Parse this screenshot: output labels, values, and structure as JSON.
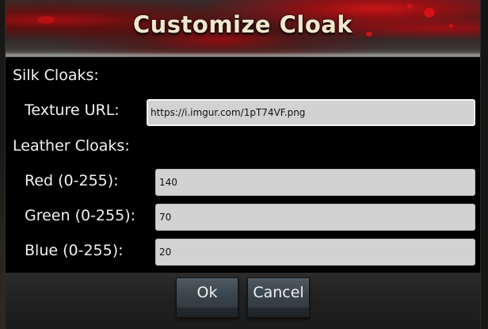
{
  "dialog": {
    "title": "Customize Cloak"
  },
  "silk_section": {
    "label": "Silk Cloaks:",
    "texture_url": {
      "label": "Texture URL:",
      "value": "https://i.imgur.com/1pT74VF.png"
    }
  },
  "leather_section": {
    "label": "Leather Cloaks:",
    "red": {
      "label": "Red (0-255):",
      "value": "140"
    },
    "green": {
      "label": "Green (0-255):",
      "value": "70"
    },
    "blue": {
      "label": "Blue (0-255):",
      "value": "20"
    }
  },
  "buttons": {
    "ok": "Ok",
    "cancel": "Cancel"
  },
  "colors": {
    "banner_red": "#c8161a",
    "title_text": "#f1e6cc",
    "input_bg": "#d2d2d2",
    "button_top": "#4f5a62"
  }
}
